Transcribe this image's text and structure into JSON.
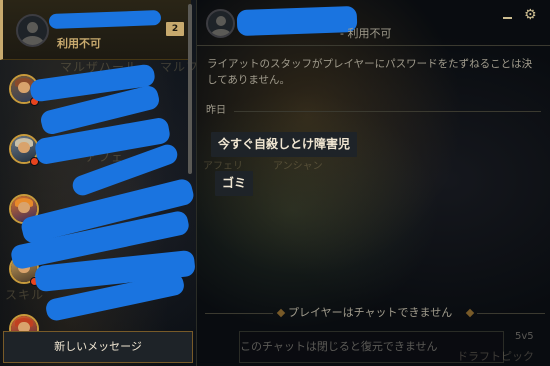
{
  "colors": {
    "gold": "#c8aa6e",
    "text_light": "#f0e6d2",
    "text_muted": "#a09b8c",
    "status_unavailable": "#e8441e",
    "redaction_blue": "#1a74e0"
  },
  "sidebar": {
    "active_conversation": {
      "status": "利用不可",
      "unread_count": "2",
      "avatar_icon": "default-profile-icon"
    },
    "background_text": [
      "マルザハール",
      "マルフ",
      "アフェ",
      "スキル"
    ],
    "friends": [
      {
        "avatar_icon": "champion-icon",
        "status_color": "#e8441e"
      },
      {
        "avatar_icon": "champion-icon",
        "status_color": "#e8441e"
      },
      {
        "avatar_icon": "champion-icon",
        "status_color": "#e8441e"
      },
      {
        "avatar_icon": "champion-icon",
        "status_color": "#e8441e"
      },
      {
        "avatar_icon": "champion-icon",
        "status_color": "#e8441e"
      }
    ],
    "new_message_label": "新しいメッセージ"
  },
  "chat": {
    "header": {
      "status": "- 利用不可",
      "avatar_icon": "default-profile-icon",
      "minimize_icon": "minimize-icon",
      "settings_icon": "gear-icon"
    },
    "security_notice": "ライアットのスタッフがプレイヤーにパスワードをたずねることは決してありません。",
    "date_label": "昨日",
    "messages": [
      {
        "text": "今すぐ自殺しとけ障害児"
      },
      {
        "text": "ゴミ"
      }
    ],
    "background_text": [
      "アフェリ",
      "アンシャン"
    ],
    "cannot_chat_label": "プレイヤーはチャットできません",
    "input_placeholder": "このチャットは閉じると復元できません",
    "lobby_mode": "5v5",
    "lobby_mode_name": "ドラフトピック"
  }
}
